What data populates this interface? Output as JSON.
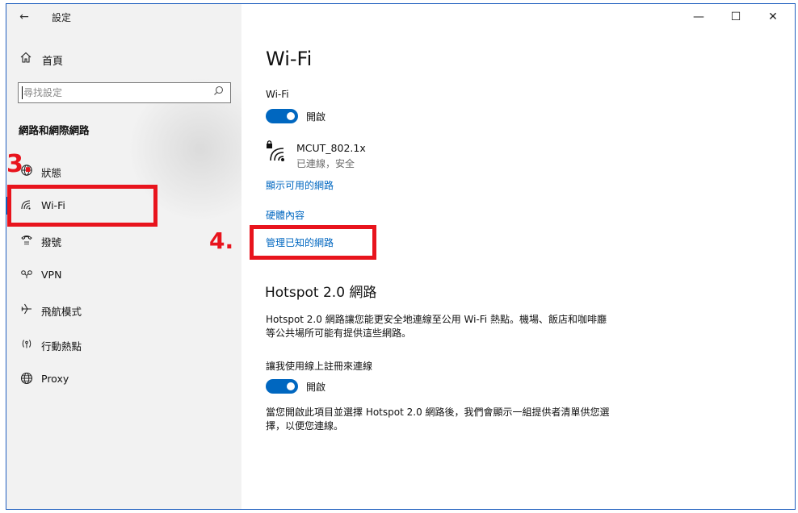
{
  "window": {
    "title": "設定",
    "controls": {
      "minimize": "—",
      "maximize": "☐",
      "close": "✕"
    }
  },
  "sidebar": {
    "back_glyph": "←",
    "home": {
      "icon": "home-icon",
      "label": "首頁"
    },
    "search": {
      "placeholder": "尋找設定",
      "value": ""
    },
    "section_heading": "網路和網際網路",
    "items": [
      {
        "id": "status",
        "icon": "globe-status-icon",
        "label": "狀態",
        "selected": false
      },
      {
        "id": "wifi",
        "icon": "wifi-icon",
        "label": "Wi-Fi",
        "selected": true
      },
      {
        "id": "dialup",
        "icon": "dialup-phone-icon",
        "label": "撥號",
        "selected": false
      },
      {
        "id": "vpn",
        "icon": "vpn-icon",
        "label": "VPN",
        "selected": false
      },
      {
        "id": "airplane",
        "icon": "airplane-icon",
        "label": "飛航模式",
        "selected": false
      },
      {
        "id": "hotspot",
        "icon": "mobile-hotspot-icon",
        "label": "行動熱點",
        "selected": false
      },
      {
        "id": "proxy",
        "icon": "globe-icon",
        "label": "Proxy",
        "selected": false
      }
    ]
  },
  "main": {
    "title": "Wi-Fi",
    "wifi_label": "Wi-Fi",
    "wifi_toggle": {
      "state": "on",
      "label": "開啟"
    },
    "network": {
      "icon": "secured-wifi-icon",
      "name": "MCUT_802.1x",
      "status": "已連線，安全"
    },
    "links": {
      "show_available": "顯示可用的網路",
      "hardware_properties": "硬體內容",
      "manage_known": "管理已知的網路"
    },
    "hotspot_section": {
      "title": "Hotspot 2.0 網路",
      "description": "Hotspot 2.0 網路讓您能更安全地連線至公用 Wi-Fi 熱點。機場、飯店和咖啡廳等公共場所可能有提供這些網路。",
      "online_signup_label": "讓我使用線上註冊來連線",
      "toggle": {
        "state": "on",
        "label": "開啟"
      },
      "footer": "當您開啟此項目並選擇 Hotspot 2.0 網路後，我們會顯示一組提供者清單供您選擇，以便您連線。"
    }
  },
  "annotations": {
    "step3": "3.",
    "step4": "4.",
    "color": "#e8141d"
  },
  "colors": {
    "accent": "#0067c0",
    "sidebar_bg": "#f2f2f2",
    "window_border": "#1f5fbf"
  }
}
